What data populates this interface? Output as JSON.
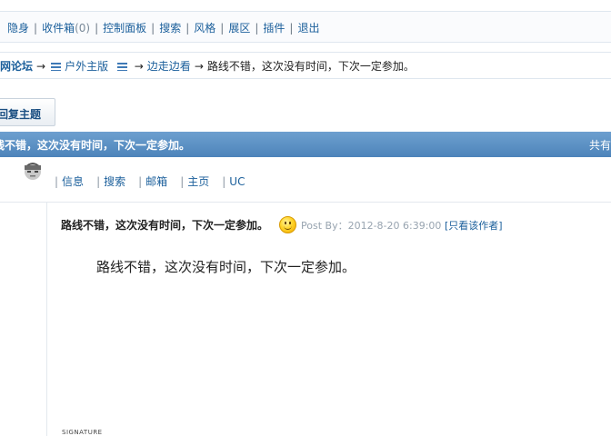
{
  "toolbar": {
    "items": [
      {
        "label": "隐身"
      },
      {
        "label": "收件箱",
        "count": "(0)"
      },
      {
        "label": "控制面板"
      },
      {
        "label": "搜索"
      },
      {
        "label": "风格"
      },
      {
        "label": "展区"
      },
      {
        "label": "插件"
      },
      {
        "label": "退出"
      }
    ]
  },
  "breadcrumb": {
    "home": "户外网论坛",
    "board": "户外主版",
    "subboard": "边走边看",
    "current": "路线不错，这次没有时间，下次一定参加。",
    "arrow": "→"
  },
  "reply_button": {
    "label": "回复主题"
  },
  "thread": {
    "title": "路线不错，这次没有时间，下次一定参加。",
    "right_text": "共有"
  },
  "post": {
    "user_links": [
      "信息",
      "搜索",
      "邮箱",
      "主页",
      "UC"
    ],
    "title": "路线不错，这次没有时间，下次一定参加。",
    "post_by_label": "Post By：",
    "datetime": "2012-8-20 6:39:00",
    "only_author": "[只看该作者]",
    "body": "路线不错，这次没有时间，下次一定参加。",
    "signature_label": "SIGNATURE"
  },
  "colors": {
    "link": "#1b5f9b",
    "titlebar": "#5a8fc4",
    "border": "#dfe7ef"
  }
}
